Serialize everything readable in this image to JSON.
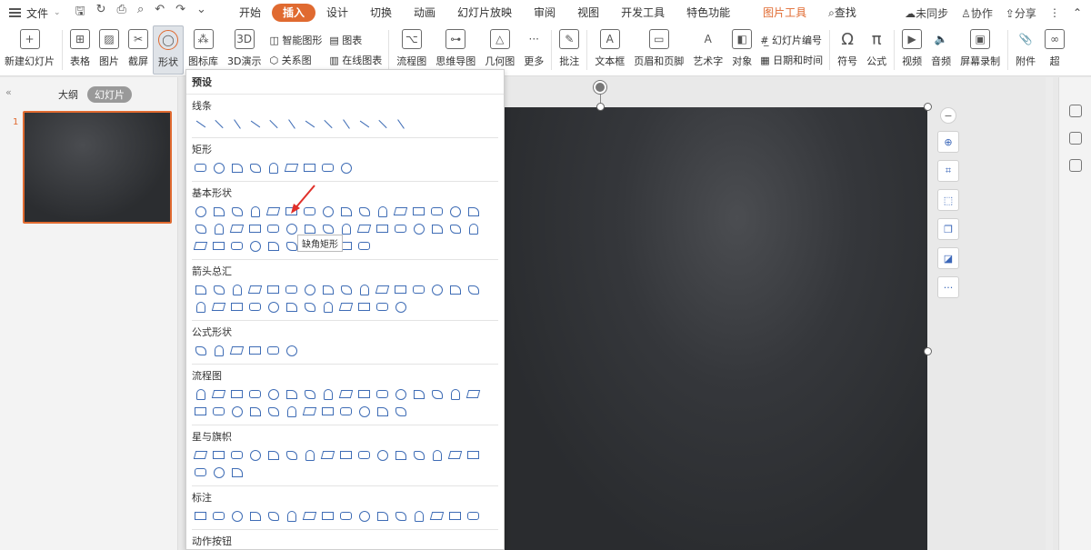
{
  "menubar": {
    "file_label": "文件",
    "tabs": [
      "开始",
      "插入",
      "设计",
      "切换",
      "动画",
      "幻灯片放映",
      "审阅",
      "视图",
      "开发工具",
      "特色功能"
    ],
    "active_tab": "插入",
    "tool_tab": "图片工具",
    "search_label": "查找",
    "sync_label": "未同步",
    "collab_label": "协作",
    "share_label": "分享"
  },
  "ribbon": {
    "new_slide": "新建幻灯片",
    "table": "表格",
    "picture": "图片",
    "screenshot": "截屏",
    "shape": "形状",
    "icon_lib": "图标库",
    "demo3d": "3D演示",
    "smart_graphic": "智能图形",
    "chart": "图表",
    "relation": "关系图",
    "online_chart": "在线图表",
    "flowchart": "流程图",
    "mindmap": "思维导图",
    "geometry": "几何图",
    "more": "更多",
    "comment": "批注",
    "textbox": "文本框",
    "header_footer": "页眉和页脚",
    "wordart": "艺术字",
    "object": "对象",
    "slide_number": "幻灯片编号",
    "datetime": "日期和时间",
    "symbol": "符号",
    "formula": "公式",
    "video": "视频",
    "audio": "音频",
    "screen_record": "屏幕录制",
    "attachment": "附件",
    "hyperlink": "超"
  },
  "left_panel": {
    "tab_outline": "大纲",
    "tab_slides": "幻灯片",
    "slide_number": "1"
  },
  "dropdown": {
    "header": "预设",
    "categories": [
      {
        "name": "线条",
        "count": 12
      },
      {
        "name": "矩形",
        "count": 9
      },
      {
        "name": "基本形状",
        "count": 42
      },
      {
        "name": "箭头总汇",
        "count": 28
      },
      {
        "name": "公式形状",
        "count": 6
      },
      {
        "name": "流程图",
        "count": 28
      },
      {
        "name": "星与旗帜",
        "count": 19
      },
      {
        "name": "标注",
        "count": 16
      },
      {
        "name": "动作按钮",
        "count": 0
      }
    ],
    "tooltip": "缺角矩形"
  },
  "colors": {
    "accent": "#e06a30",
    "shape_stroke": "#3e6cb5",
    "chalkboard": "#2c2e31"
  }
}
